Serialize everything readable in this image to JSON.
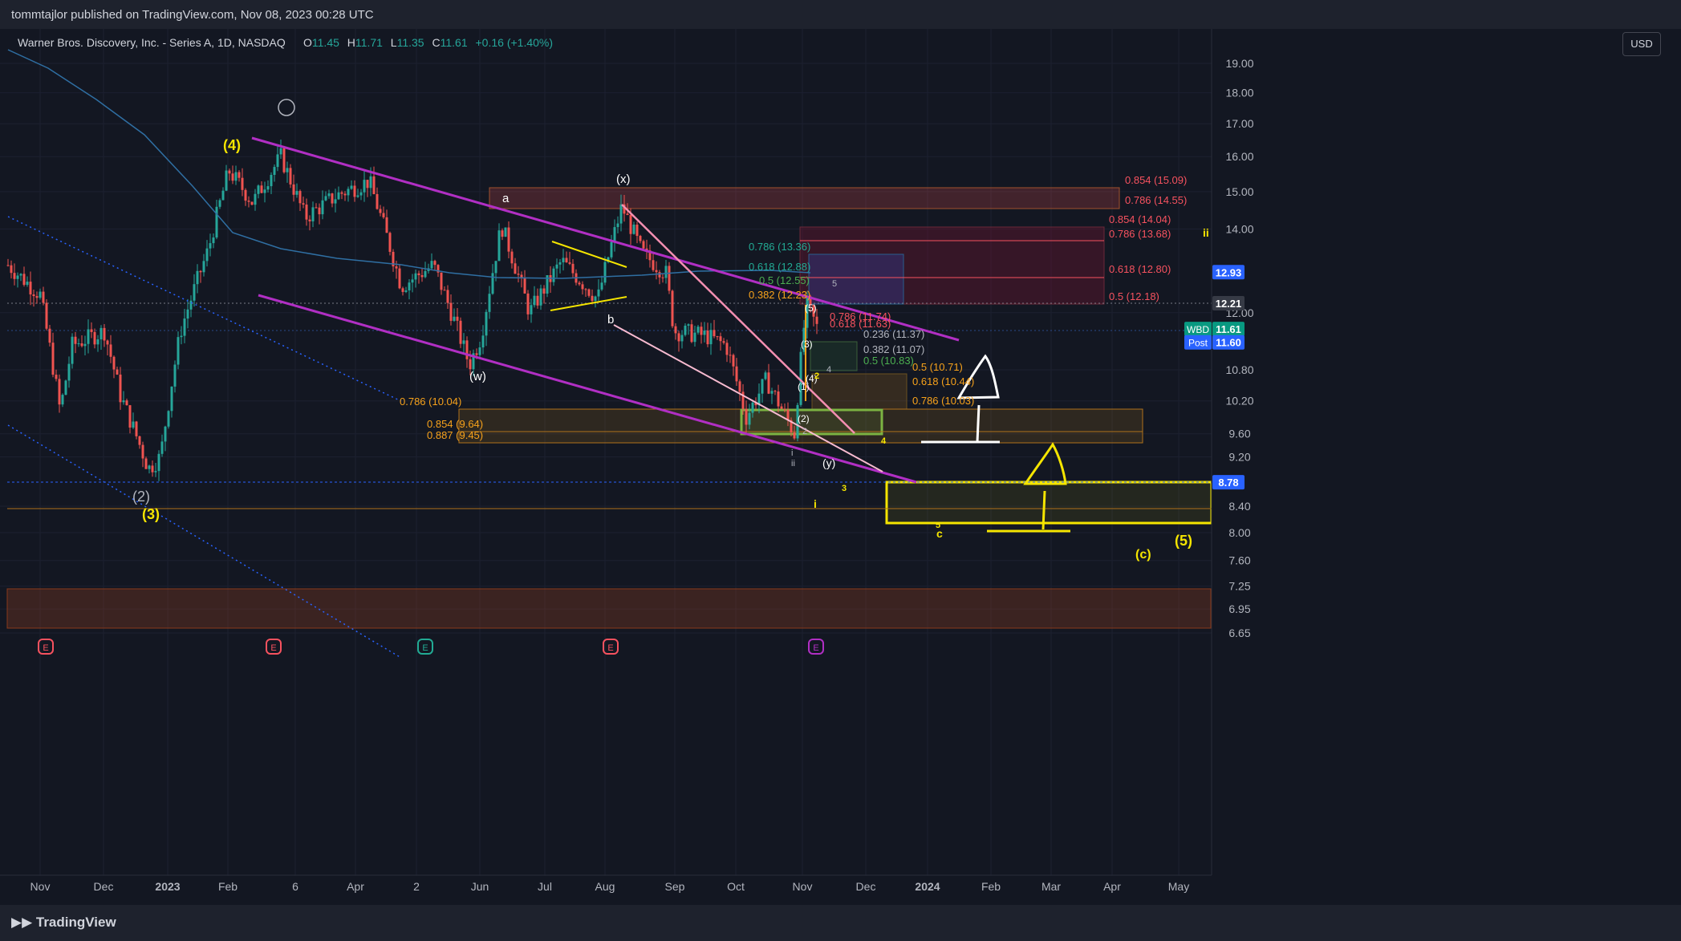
{
  "header": {
    "published": "tommtajlor published on TradingView.com, Nov 08, 2023 00:28 UTC"
  },
  "footer": {
    "brand": "TradingView"
  },
  "currency_button": "USD",
  "legend": {
    "name": "Warner Bros. Discovery, Inc. - Series A, 1D, NASDAQ",
    "o_label": "O",
    "o": "11.45",
    "h_label": "H",
    "h": "11.71",
    "l_label": "L",
    "l": "11.35",
    "c_label": "C",
    "c": "11.61",
    "change": "+0.16 (+1.40%)"
  },
  "colors": {
    "up": "#26a69a",
    "down": "#ef5350",
    "channel": "#b12fc4",
    "fib": "#f7a21b",
    "yellow": "#f5e500",
    "green_box": "#7cb342",
    "ma": "#2f6fa3",
    "bg": "#131722"
  },
  "chart_data": {
    "type": "candlestick",
    "symbol": "WBD",
    "interval": "1D",
    "y_axis": {
      "ticks": [
        "19.00",
        "18.00",
        "17.00",
        "16.00",
        "15.00",
        "14.00",
        "12.00",
        "10.80",
        "10.20",
        "9.60",
        "9.20",
        "8.40",
        "8.00",
        "7.60",
        "7.25",
        "6.95",
        "6.65"
      ],
      "scale": "log"
    },
    "x_axis": {
      "ticks": [
        "Nov",
        "Dec",
        "2023",
        "Feb",
        "6",
        "Apr",
        "2",
        "Jun",
        "Jul",
        "Aug",
        "Sep",
        "Oct",
        "Nov",
        "Dec",
        "2024",
        "Feb",
        "Mar",
        "Apr",
        "May"
      ]
    },
    "price_badges": [
      {
        "label": "",
        "value": "12.93",
        "color": "#2962ff"
      },
      {
        "label": "",
        "value": "12.21",
        "color": "#363a45"
      },
      {
        "label": "WBD",
        "value": "11.61",
        "color": "#089981"
      },
      {
        "label": "Post",
        "value": "11.60",
        "color": "#2962ff"
      },
      {
        "label": "",
        "value": "8.78",
        "color": "#2962ff"
      }
    ],
    "fib_labels": [
      {
        "text": "0.854 (15.09)",
        "color": "#f7525f"
      },
      {
        "text": "0.786 (14.55)",
        "color": "#f7525f"
      },
      {
        "text": "0.854 (14.04)",
        "color": "#f7525f"
      },
      {
        "text": "0.786 (13.68)",
        "color": "#f7525f"
      },
      {
        "text": "0.618 (12.80)",
        "color": "#f7525f"
      },
      {
        "text": "0.5 (12.18)",
        "color": "#f7525f"
      },
      {
        "text": "0.786 (13.36)",
        "color": "#22ab94"
      },
      {
        "text": "0.618 (12.88)",
        "color": "#22ab94"
      },
      {
        "text": "0.5 (12.55)",
        "color": "#4caf50"
      },
      {
        "text": "0.382 (12.23)",
        "color": "#f7a21b"
      },
      {
        "text": "0.786 (11.74)",
        "color": "#f7525f"
      },
      {
        "text": "0.618 (11.63)",
        "color": "#f7525f"
      },
      {
        "text": "0.236 (11.37)",
        "color": "#b2b5be"
      },
      {
        "text": "0.382 (11.07)",
        "color": "#b2b5be"
      },
      {
        "text": "0.5 (10.83)",
        "color": "#4caf50"
      },
      {
        "text": "0.5 (10.71)",
        "color": "#f7a21b"
      },
      {
        "text": "0.618 (10.44)",
        "color": "#f7a21b"
      },
      {
        "text": "0.786 (10.03)",
        "color": "#f7a21b"
      },
      {
        "text": "0.786 (10.04)",
        "color": "#f7a21b"
      },
      {
        "text": "0.854 (9.64)",
        "color": "#f7a21b"
      },
      {
        "text": "0.887 (9.45)",
        "color": "#f7a21b"
      }
    ],
    "wave_labels": [
      {
        "text": "(4)",
        "color": "#f5e500"
      },
      {
        "text": "(2)",
        "color": "#b2b5be"
      },
      {
        "text": "(3)",
        "color": "#f5e500"
      },
      {
        "text": "(5)",
        "color": "#f5e500"
      },
      {
        "text": "(c)",
        "color": "#f5e500"
      },
      {
        "text": "c",
        "color": "#f5e500"
      },
      {
        "text": "i",
        "color": "#f5e500"
      },
      {
        "text": "ii",
        "color": "#f5e500"
      },
      {
        "text": "a",
        "color": "#ffffff"
      },
      {
        "text": "b",
        "color": "#ffffff"
      },
      {
        "text": "(x)",
        "color": "#ffffff"
      },
      {
        "text": "(w)",
        "color": "#ffffff"
      },
      {
        "text": "(y)",
        "color": "#ffffff"
      },
      {
        "text": "(1)",
        "color": "#ffffff"
      },
      {
        "text": "(2)",
        "color": "#ffffff"
      },
      {
        "text": "(3)",
        "color": "#ffffff"
      },
      {
        "text": "(4)",
        "color": "#ffffff"
      },
      {
        "text": "(5)",
        "color": "#ffffff"
      },
      {
        "text": "i",
        "color": "#b2b5be"
      },
      {
        "text": "ii",
        "color": "#b2b5be"
      },
      {
        "text": "5",
        "color": "#b2b5be"
      },
      {
        "text": "2",
        "color": "#f5e500"
      },
      {
        "text": "3",
        "color": "#f5e500"
      },
      {
        "text": "4",
        "color": "#f5e500"
      },
      {
        "text": "5",
        "color": "#f5e500"
      },
      {
        "text": "4",
        "color": "#b2b5be"
      },
      {
        "text": "2",
        "color": "#b2b5be"
      }
    ],
    "events": [
      "E",
      "E",
      "E",
      "E",
      "E"
    ]
  }
}
